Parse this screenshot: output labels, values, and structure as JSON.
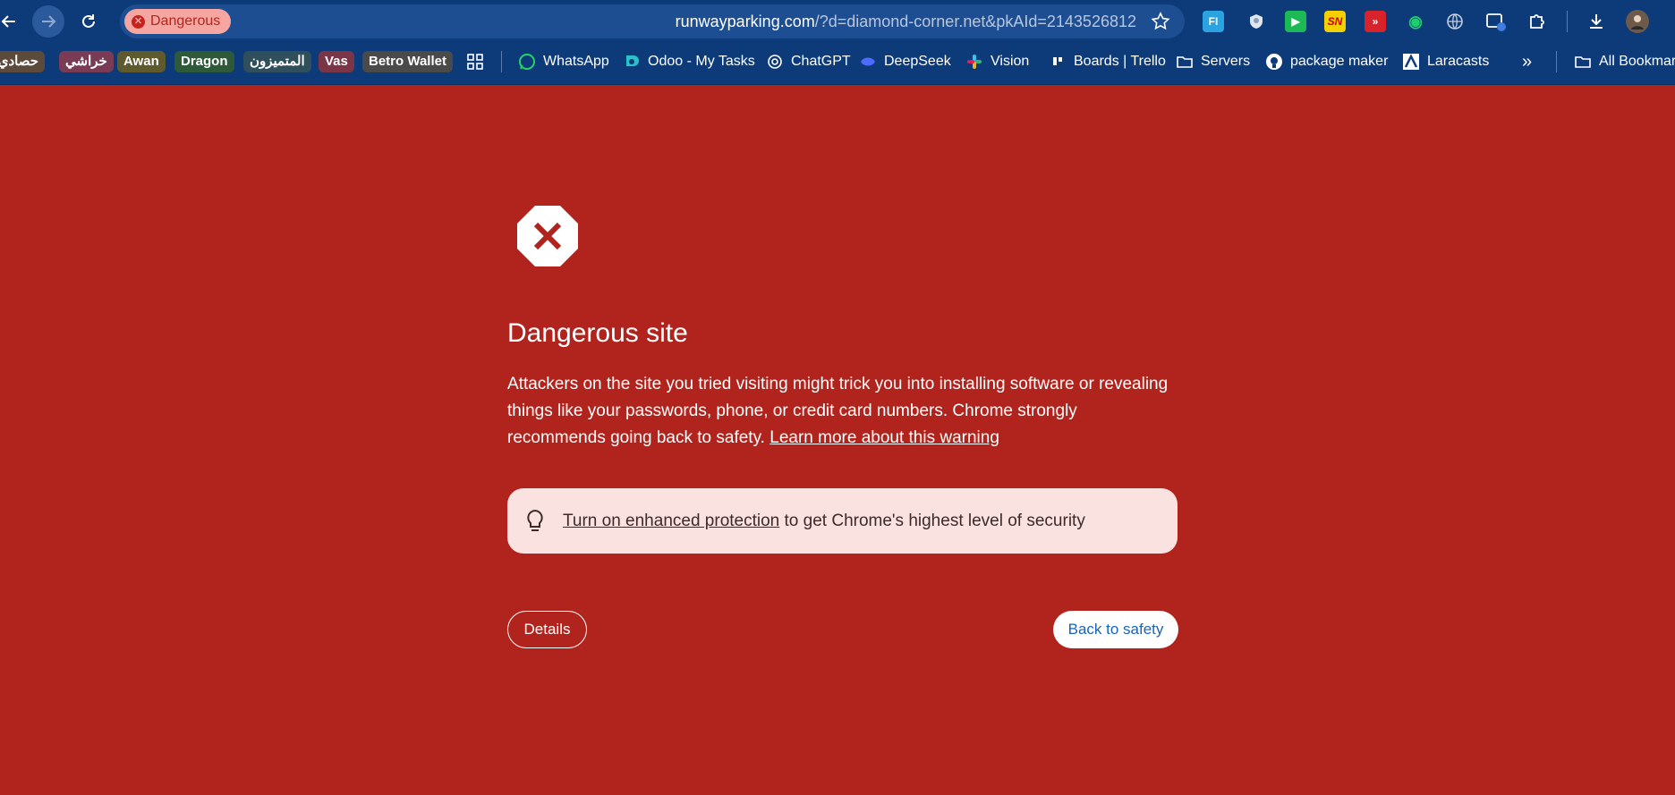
{
  "toolbar": {
    "security_chip": "Dangerous",
    "url_host": "runwayparking.com",
    "url_rest": "/?d=diamond-corner.net&pkAId=2143526812",
    "icons": [
      "back-icon",
      "forward-icon",
      "reload-icon",
      "star-icon",
      "download-icon",
      "profile-avatar"
    ]
  },
  "bookmarks": {
    "groups": [
      {
        "label": "حصادي",
        "color": "#5c4a3a"
      },
      {
        "label": "خراشي",
        "color": "#7a3b55"
      },
      {
        "label": "Awan",
        "color": "#5e5a2e"
      },
      {
        "label": "Dragon",
        "color": "#2f5a3a"
      },
      {
        "label": "المتميزون",
        "color": "#2f4f5c"
      },
      {
        "label": "Vas",
        "color": "#7a3547"
      },
      {
        "label": "Betro Wallet",
        "color": "#4a4a4a"
      }
    ],
    "items": [
      {
        "label": "WhatsApp",
        "icon": "whatsapp-icon"
      },
      {
        "label": "Odoo - My Tasks",
        "icon": "odoo-icon"
      },
      {
        "label": "ChatGPT",
        "icon": "chatgpt-icon"
      },
      {
        "label": "DeepSeek",
        "icon": "deepseek-icon"
      },
      {
        "label": "Vision",
        "icon": "slack-icon"
      },
      {
        "label": "Boards | Trello",
        "icon": "trello-icon"
      },
      {
        "label": "Servers",
        "icon": "folder-icon"
      },
      {
        "label": "package maker",
        "icon": "github-icon"
      },
      {
        "label": "Laracasts",
        "icon": "laracasts-icon"
      }
    ],
    "overflow": "»",
    "all_bookmarks": "All Bookmarks"
  },
  "page": {
    "heading": "Dangerous site",
    "body": "Attackers on the site you tried visiting might trick you into installing software or revealing things like your passwords, phone, or credit card numbers. Chrome strongly recommends going back to safety. ",
    "learn_more": "Learn more about this warning",
    "tip_link": "Turn on enhanced protection",
    "tip_rest": " to get Chrome's highest level of security",
    "details_button": "Details",
    "back_button": "Back to safety"
  },
  "colors": {
    "page_bg": "#b1241d",
    "toolbar_bg": "#0d3b7a",
    "tip_bg": "#fae2e0",
    "back_button_text": "#1a63b8"
  }
}
